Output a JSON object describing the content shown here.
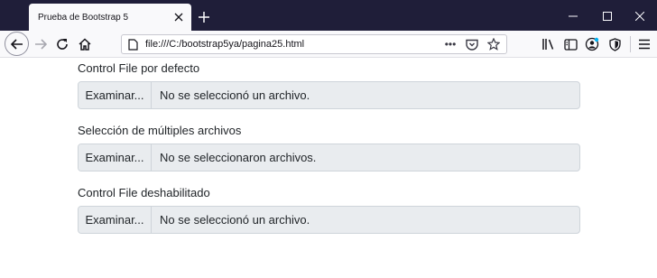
{
  "browser": {
    "tab_title": "Prueba de Bootstrap 5",
    "url": "file:///C:/bootstrap5ya/pagina25.html",
    "url_menu_glyph": "•••"
  },
  "page": {
    "groups": [
      {
        "label": "Control File por defecto",
        "button_label": "Examinar...",
        "status": "No se seleccionó un archivo."
      },
      {
        "label": "Selección de múltiples archivos",
        "button_label": "Examinar...",
        "status": "No se seleccionaron archivos."
      },
      {
        "label": "Control File deshabilitado",
        "button_label": "Examinar...",
        "status": "No se seleccionó un archivo."
      }
    ]
  },
  "colors": {
    "tabbar_bg": "#1f1e39",
    "toolbar_bg": "#f9f9fb",
    "input_bg": "#e9ecef",
    "input_border": "#ced4da",
    "text": "#212529",
    "account_badge": "#00b3f4"
  }
}
